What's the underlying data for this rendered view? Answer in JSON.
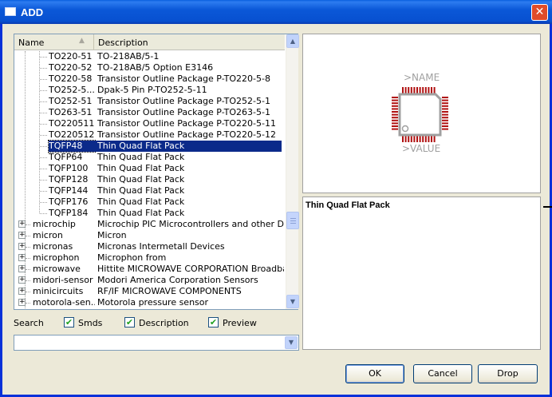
{
  "window": {
    "title": "ADD",
    "close_glyph": "✕"
  },
  "list": {
    "headers": {
      "name": "Name",
      "description": "Description"
    },
    "rows": [
      {
        "name": "TO220-51",
        "desc": "TO-218AB/5-1",
        "kind": "child"
      },
      {
        "name": "TO220-52",
        "desc": "TO-218AB/5 Option E3146",
        "kind": "child"
      },
      {
        "name": "TO220-58",
        "desc": "Transistor Outline Package P-TO220-5-8",
        "kind": "child"
      },
      {
        "name": "TO252-5...",
        "desc": "Dpak-5 Pin P-TO252-5-11",
        "kind": "child"
      },
      {
        "name": "TO252-51",
        "desc": "Transistor Outline Package P-TO252-5-1",
        "kind": "child"
      },
      {
        "name": "TO263-51",
        "desc": "Transistor Outline Package P-TO263-5-1",
        "kind": "child"
      },
      {
        "name": "TO220511",
        "desc": "Transistor Outline Package P-TO220-5-11",
        "kind": "child"
      },
      {
        "name": "TO220512",
        "desc": "Transistor Outline Package P-TO220-5-12",
        "kind": "child"
      },
      {
        "name": "TQFP48",
        "desc": "Thin Quad Flat Pack",
        "kind": "child",
        "selected": true
      },
      {
        "name": "TQFP64",
        "desc": "Thin Quad Flat Pack",
        "kind": "child"
      },
      {
        "name": "TQFP100",
        "desc": "Thin Quad Flat Pack",
        "kind": "child"
      },
      {
        "name": "TQFP128",
        "desc": "Thin Quad Flat Pack",
        "kind": "child"
      },
      {
        "name": "TQFP144",
        "desc": "Thin Quad Flat Pack",
        "kind": "child"
      },
      {
        "name": "TQFP176",
        "desc": "Thin Quad Flat Pack",
        "kind": "child"
      },
      {
        "name": "TQFP184",
        "desc": "Thin Quad Flat Pack",
        "kind": "child"
      },
      {
        "name": "microchip",
        "desc": "Microchip PIC Microcontrollers and other Devic...",
        "kind": "group"
      },
      {
        "name": "micron",
        "desc": "Micron",
        "kind": "group"
      },
      {
        "name": "micronas",
        "desc": "Micronas Intermetall Devices",
        "kind": "group"
      },
      {
        "name": "microphon",
        "desc": "Microphon from",
        "kind": "group"
      },
      {
        "name": "microwave",
        "desc": "Hittite MICROWAVE CORPORATION Broadban...",
        "kind": "group"
      },
      {
        "name": "midori-sensor",
        "desc": "Modori America Corporation Sensors",
        "kind": "group"
      },
      {
        "name": "minicircuits",
        "desc": "RF/IF MICROWAVE COMPONENTS",
        "kind": "group"
      },
      {
        "name": "motorola-sen...",
        "desc": "Motorola pressure sensor",
        "kind": "group"
      }
    ]
  },
  "search": {
    "label": "Search",
    "options": [
      {
        "label": "Smds",
        "checked": true
      },
      {
        "label": "Description",
        "checked": true
      },
      {
        "label": "Preview",
        "checked": true
      }
    ],
    "value": "",
    "check_glyph": "✔"
  },
  "preview": {
    "name_text": ">NAME",
    "value_text": ">VALUE",
    "pad_color": "#b01010",
    "outline_color": "#a0a0a0"
  },
  "description_text": "Thin Quad Flat Pack",
  "buttons": {
    "ok": "OK",
    "cancel": "Cancel",
    "drop": "Drop"
  },
  "glyphs": {
    "expand": "+",
    "sort_up": "▲",
    "scroll_up": "▲",
    "scroll_down": "▼",
    "combo_arrow": "▼"
  }
}
